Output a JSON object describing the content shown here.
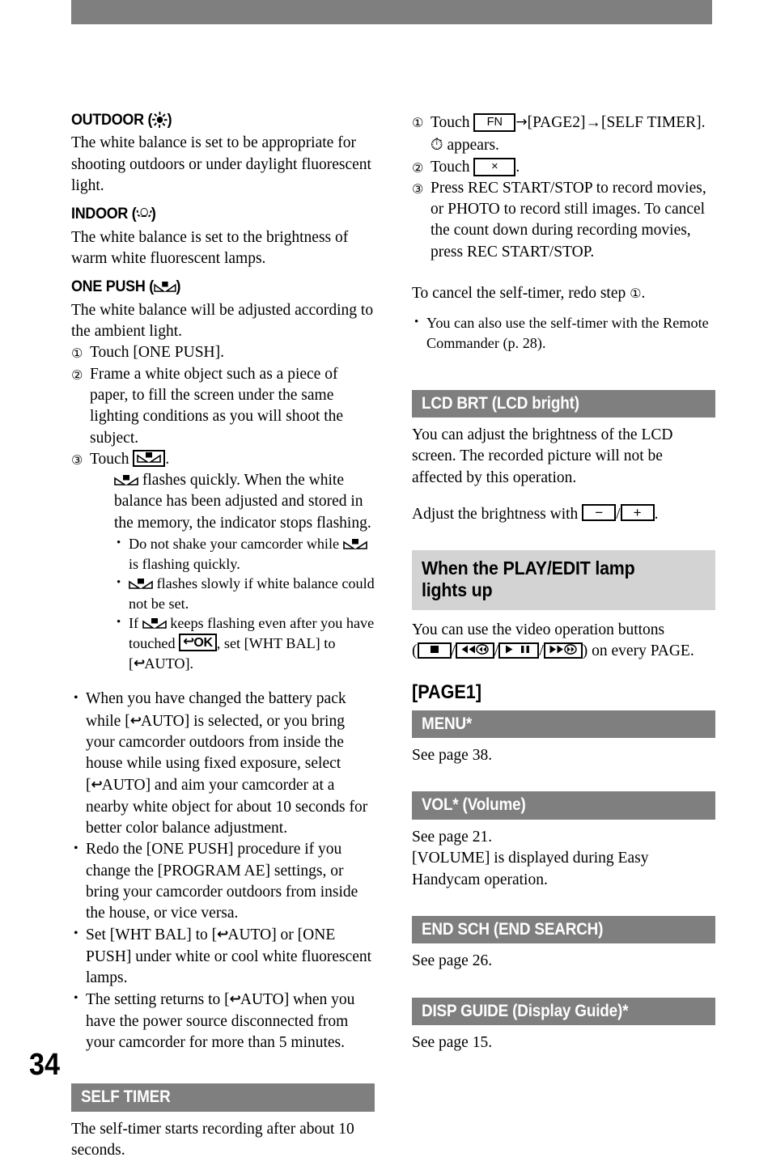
{
  "page": {
    "folio": "34",
    "top_bar_color": "#7f7f7f",
    "section_bar_color": "#7f7f7f",
    "light_bar_color": "#d3d3d3"
  },
  "left_column": {
    "outdoor": {
      "heading_text": "OUTDOOR (",
      "heading_close": ")",
      "icon": "sun-icon",
      "body": "The white balance is set to be appropriate for shooting outdoors or under daylight fluorescent light."
    },
    "indoor": {
      "heading_text": "INDOOR (",
      "heading_close": ")",
      "icon": "lamp-icon",
      "body": "The white balance is set to the brightness of warm white fluorescent lamps."
    },
    "one_push": {
      "heading_text": "ONE PUSH (",
      "heading_close": ")",
      "icon": "one-push-wb-icon",
      "body": "The white balance will be adjusted according to the ambient light.",
      "steps": [
        {
          "num": "①",
          "text": "Touch [ONE PUSH]."
        },
        {
          "num": "②",
          "text": "Frame a white object such as a piece of paper, to fill the screen under the same lighting conditions as you will shoot the subject."
        },
        {
          "num": "③",
          "text_before": "Touch ",
          "text_after": "."
        }
      ],
      "step3_note_before": " flashes quickly. When the white balance has been adjusted and stored in the memory, the indicator stops flashing.",
      "sub_bullets": [
        {
          "before": "Do not shake your camcorder while ",
          "after": " is flashing quickly."
        },
        {
          "before": "",
          "after": " flashes slowly if white balance could not be set."
        },
        {
          "before": "If ",
          "mid": " keeps flashing even after you have touched ",
          "ok_label": "OK",
          "after": ", set [WHT BAL] to [",
          "auto_label": "AUTO",
          "end": "]."
        }
      ]
    },
    "notes": [
      {
        "p1": "When you have changed the battery pack while [",
        "auto1": "AUTO",
        "p2": "] is selected, or you bring your camcorder outdoors from inside the house while using fixed exposure, select [",
        "auto2": "AUTO",
        "p3": "] and aim your camcorder at a nearby white object for about 10 seconds for better color balance adjustment."
      },
      {
        "p1": "Redo the [ONE PUSH] procedure if you change the [PROGRAM AE] settings, or bring your camcorder outdoors from inside the house, or vice versa."
      },
      {
        "p1": "Set [WHT BAL] to [",
        "auto1": "AUTO",
        "p2": "] or [ONE PUSH] under white or cool white fluorescent lamps."
      },
      {
        "p1": "The setting returns to [",
        "auto1": "AUTO",
        "p2": "] when you have the power source disconnected from your camcorder for more than 5 minutes."
      }
    ],
    "self_timer": {
      "bar_label": "SELF TIMER",
      "body": "The self-timer starts recording after about 10 seconds."
    }
  },
  "right_column": {
    "self_timer_steps": [
      {
        "num": "①",
        "before": "Touch ",
        "fn_label": "FN",
        "arrow": "→",
        "after": "[PAGE2]→[SELF TIMER].",
        "note_icon": "self-timer-clock-icon",
        "note": " appears."
      },
      {
        "num": "②",
        "before": "Touch ",
        "x_label": "×",
        "after": "."
      },
      {
        "num": "③",
        "text": "Press REC START/STOP to record movies, or PHOTO to record still images. To cancel the count down during recording movies, press REC START/STOP."
      }
    ],
    "cancel_line_before": "To cancel the self-timer, redo step ",
    "cancel_step_num": "①",
    "cancel_line_after": ".",
    "remote_bullet": "You can also use the self-timer with the Remote Commander (p. 28).",
    "lcd_brt": {
      "bar_label": "LCD BRT (LCD bright)",
      "body": "You can adjust the brightness of the LCD screen. The recorded picture will not be affected by this operation.",
      "adjust_before": "Adjust the brightness with ",
      "minus_label": "−",
      "slash": "/",
      "plus_label": "+",
      "adjust_after": "."
    },
    "play_edit": {
      "bar_label_line1": "When the PLAY/EDIT lamp",
      "bar_label_line2": "lights up",
      "body_before": "You can use the video operation buttons",
      "body_paren_open": "(",
      "buttons": [
        "stop-button-icon",
        "rewind-button-icon",
        "play-pause-button-icon",
        "fast-forward-button-icon"
      ],
      "body_paren_close": ")",
      "body_after": " on every PAGE."
    },
    "page1_tag": "[PAGE1]",
    "sections": [
      {
        "bar_label": "MENU*",
        "body": "See page 38."
      },
      {
        "bar_label": "VOL* (Volume)",
        "body": "See page 21.\n[VOLUME] is displayed during Easy Handycam operation."
      },
      {
        "bar_label": "END SCH (END SEARCH)",
        "body": "See page 26."
      },
      {
        "bar_label": "DISP GUIDE (Display Guide)*",
        "body": "See page 15."
      }
    ]
  }
}
